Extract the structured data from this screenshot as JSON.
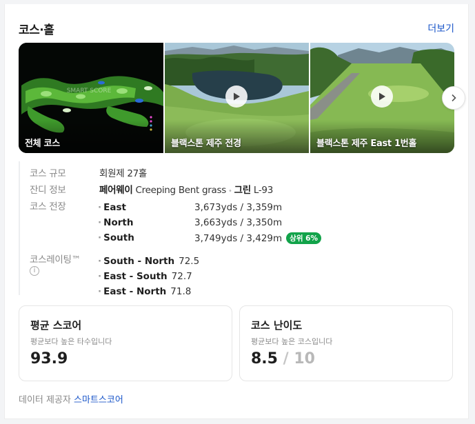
{
  "header": {
    "title": "코스·홀",
    "more_label": "더보기"
  },
  "gallery": {
    "tiles": [
      {
        "label": "전체 코스",
        "image": "course-map"
      },
      {
        "label": "블랙스톤 제주 전경",
        "image": "lake-view-video"
      },
      {
        "label": "블랙스톤 제주 East 1번홀",
        "image": "fairway-video"
      }
    ],
    "map_text": "SMART SCORE"
  },
  "info": {
    "size_label": "코스 규모",
    "size_value": "회원제 27홀",
    "grass_label": "잔디 정보",
    "fairway_label": "페어웨이",
    "fairway_value": "Creeping Bent grass",
    "green_label": "그린",
    "green_value": "L-93",
    "length_label": "코스 전장",
    "lengths": [
      {
        "course": "East",
        "value": "3,673yds / 3,359m"
      },
      {
        "course": "North",
        "value": "3,663yds / 3,350m"
      },
      {
        "course": "South",
        "value": "3,749yds / 3,429m",
        "badge": "상위 6%"
      }
    ],
    "rating_label": "코스레이팅™",
    "ratings": [
      {
        "course": "South - North",
        "value": "72.5"
      },
      {
        "course": "East - South",
        "value": "72.7"
      },
      {
        "course": "East - North",
        "value": "71.8"
      }
    ]
  },
  "avg_score": {
    "title": "평균 스코어",
    "sub": "평균보다 높은 타수입니다",
    "value": "93.9"
  },
  "difficulty": {
    "title": "코스 난이도",
    "sub": "평균보다 높은 코스입니다",
    "value": "8.5",
    "slash": "/",
    "max": "10"
  },
  "footer": {
    "prefix": "데이터 제공자",
    "provider": "스마트스코어"
  },
  "colors": {
    "link": "#1a56c9",
    "badge": "#12a34a"
  }
}
